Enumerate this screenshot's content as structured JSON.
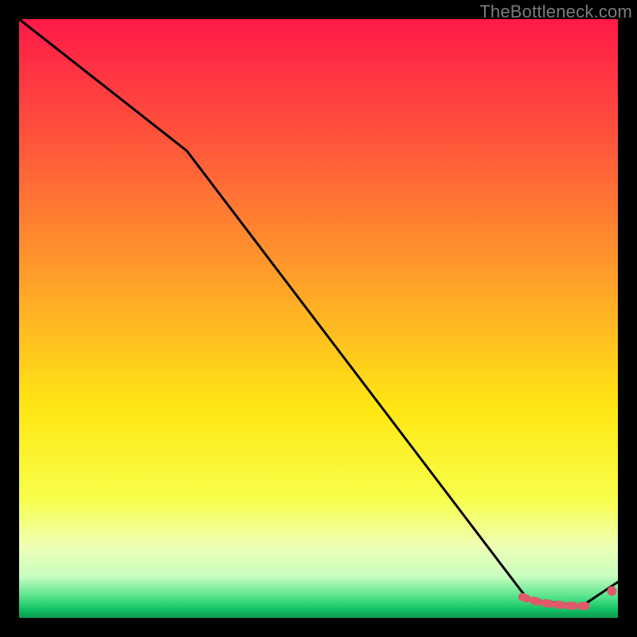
{
  "watermark": "TheBottleneck.com",
  "chart_data": {
    "type": "line",
    "title": "",
    "xlabel": "",
    "ylabel": "",
    "xlim": [
      0,
      100
    ],
    "ylim": [
      0,
      100
    ],
    "series": [
      {
        "name": "main-curve",
        "x": [
          0,
          28,
          85,
          94,
          100
        ],
        "y": [
          100,
          78,
          3,
          2,
          6
        ],
        "color": "#000000"
      }
    ],
    "valley_markers": {
      "color": "#e05a6a",
      "points": [
        {
          "x": 84,
          "y": 3.5
        },
        {
          "x": 85.5,
          "y": 3.0
        },
        {
          "x": 87,
          "y": 2.6
        },
        {
          "x": 89,
          "y": 2.3
        },
        {
          "x": 91,
          "y": 2.1
        },
        {
          "x": 93,
          "y": 2.0
        },
        {
          "x": 95,
          "y": 2.0
        }
      ],
      "end_point": {
        "x": 99,
        "y": 4.5
      }
    },
    "gradient_stops": [
      {
        "offset": 0.0,
        "color": "#ff1a48"
      },
      {
        "offset": 0.22,
        "color": "#ff5a3a"
      },
      {
        "offset": 0.45,
        "color": "#ffa528"
      },
      {
        "offset": 0.65,
        "color": "#ffe713"
      },
      {
        "offset": 0.8,
        "color": "#f8ff4a"
      },
      {
        "offset": 0.88,
        "color": "#efffb5"
      },
      {
        "offset": 0.93,
        "color": "#c8ffc0"
      },
      {
        "offset": 0.965,
        "color": "#55e38a"
      },
      {
        "offset": 0.985,
        "color": "#14c465"
      },
      {
        "offset": 1.0,
        "color": "#0a9a50"
      }
    ]
  }
}
